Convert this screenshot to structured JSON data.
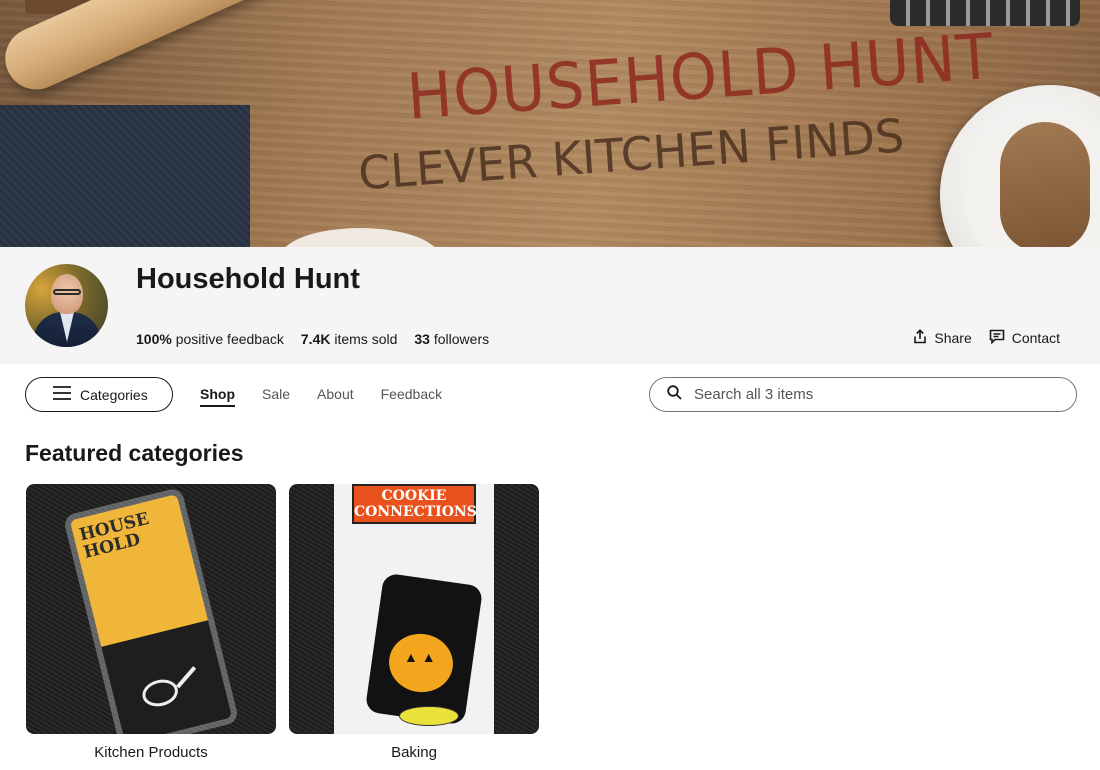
{
  "banner": {
    "line1": "HOUSEHOLD HUNT",
    "line2": "CLEVER KITCHEN FINDS"
  },
  "store": {
    "name": "Household Hunt",
    "feedback_value": "100%",
    "feedback_label": "positive feedback",
    "sold_value": "7.4K",
    "sold_label": "items sold",
    "followers_value": "33",
    "followers_label": "followers",
    "share_label": "Share",
    "contact_label": "Contact"
  },
  "nav": {
    "categories_label": "Categories",
    "tabs": [
      {
        "label": "Shop",
        "active": true
      },
      {
        "label": "Sale",
        "active": false
      },
      {
        "label": "About",
        "active": false
      },
      {
        "label": "Feedback",
        "active": false
      }
    ],
    "search_placeholder": "Search all 3 items"
  },
  "featured": {
    "title": "Featured categories",
    "items": [
      {
        "label": "Kitchen Products",
        "brand_text": "HOUSE HOLD"
      },
      {
        "label": "Baking",
        "brand_text": "COOKIE CONNECTIONS"
      }
    ]
  },
  "icons": {
    "share": "share-icon",
    "contact": "message-icon",
    "menu": "hamburger-icon",
    "search": "search-icon"
  },
  "colors": {
    "header_bg": "#f5f5f5",
    "text": "#191919",
    "banner_red": "#8e2a1f"
  }
}
